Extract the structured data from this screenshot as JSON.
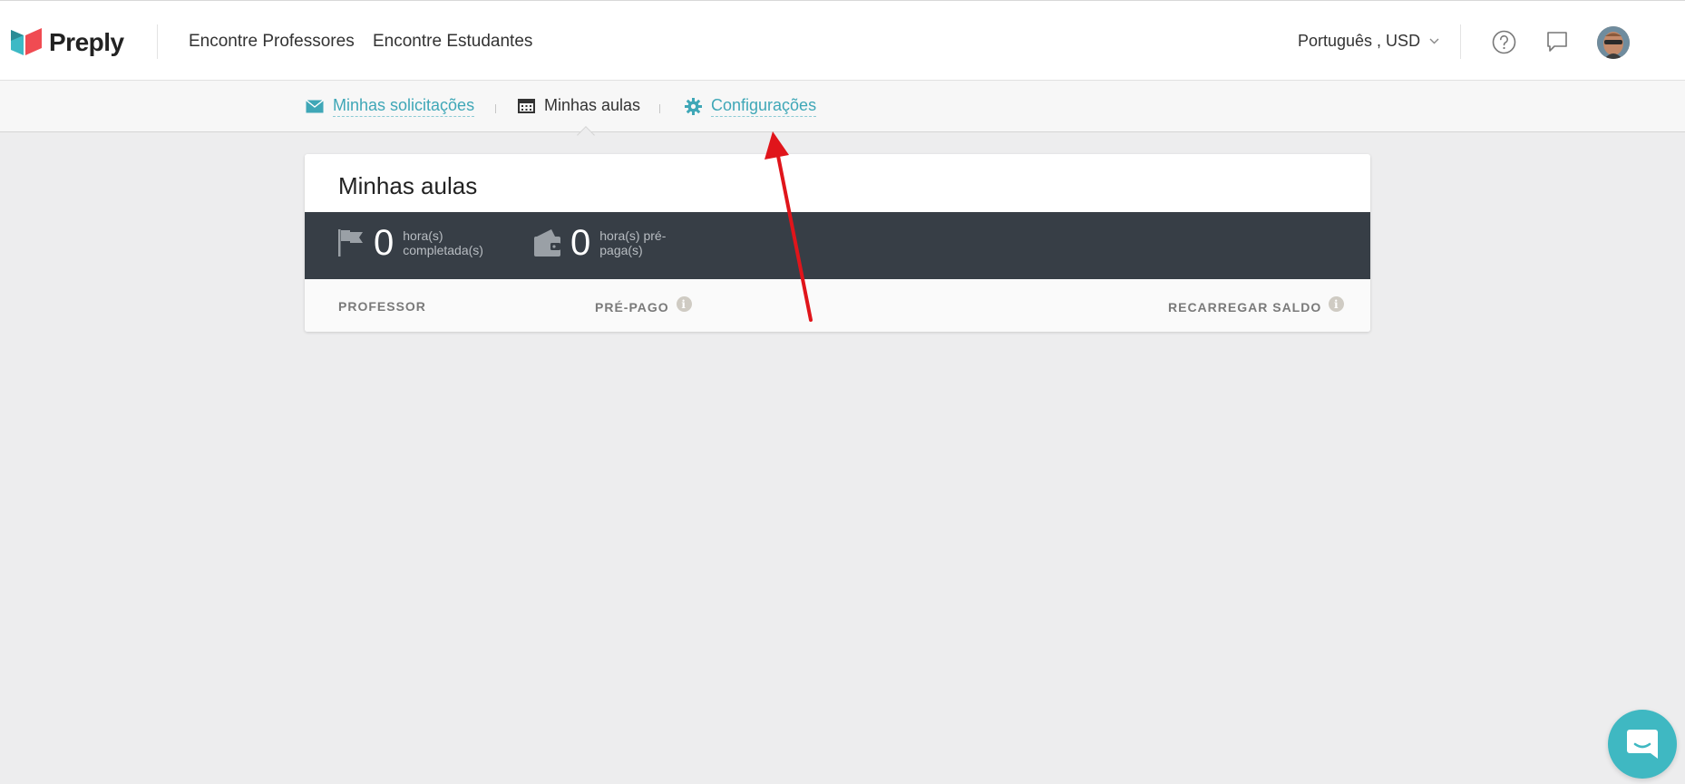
{
  "header": {
    "logo_text": "Preply",
    "nav": [
      "Encontre Professores",
      "Encontre Estudantes"
    ],
    "language_currency": "Português , USD"
  },
  "subnav": {
    "items": [
      {
        "label": "Minhas solicitações",
        "icon": "envelope-icon"
      },
      {
        "label": "Minhas aulas",
        "icon": "calendar-icon"
      },
      {
        "label": "Configurações",
        "icon": "gear-icon"
      }
    ]
  },
  "card": {
    "title": "Minhas aulas",
    "stats": [
      {
        "value": "0",
        "label": "hora(s) completada(s)",
        "icon": "flag-icon"
      },
      {
        "value": "0",
        "label": "hora(s) pré-paga(s)",
        "icon": "wallet-icon"
      }
    ],
    "columns": [
      "PROFESSOR",
      "PRÉ-PAGO",
      "RECARREGAR SALDO"
    ]
  },
  "colors": {
    "accent": "#3fa7b7",
    "stats_bar": "#373e46",
    "annotation_arrow": "#e0151b",
    "chat_button": "#3fb8c2"
  }
}
